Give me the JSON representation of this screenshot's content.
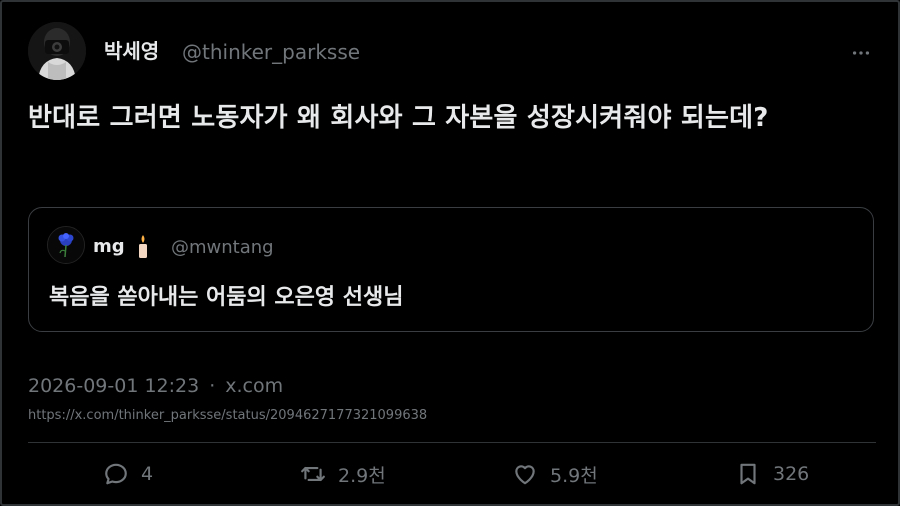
{
  "author": {
    "name": "박세영",
    "handle": "@thinker_parksse"
  },
  "tweet": {
    "text": "반대로 그러면 노동자가 왜 회사와 그 자본을 성장시켜줘야 되는데?"
  },
  "quote": {
    "name": "mg",
    "handle": "@mwntang",
    "text": "복음을 쏟아내는 어둠의 오은영 선생님"
  },
  "meta": {
    "timestamp": "2026-09-01 12:23",
    "separator": "·",
    "source": "x.com",
    "url": "https://x.com/thinker_parksse/status/2094627177321099638"
  },
  "actions": {
    "replies": "4",
    "retweets": "2.9천",
    "likes": "5.9천",
    "bookmarks": "326"
  },
  "icons": {
    "more": "more-horizontal-icon",
    "reply": "reply-icon",
    "retweet": "retweet-icon",
    "like": "heart-icon",
    "bookmark": "bookmark-icon",
    "candle": "candle-icon"
  },
  "colors": {
    "background": "#000000",
    "text": "#e7e9ea",
    "muted": "#71767b",
    "border": "#2f3336"
  }
}
